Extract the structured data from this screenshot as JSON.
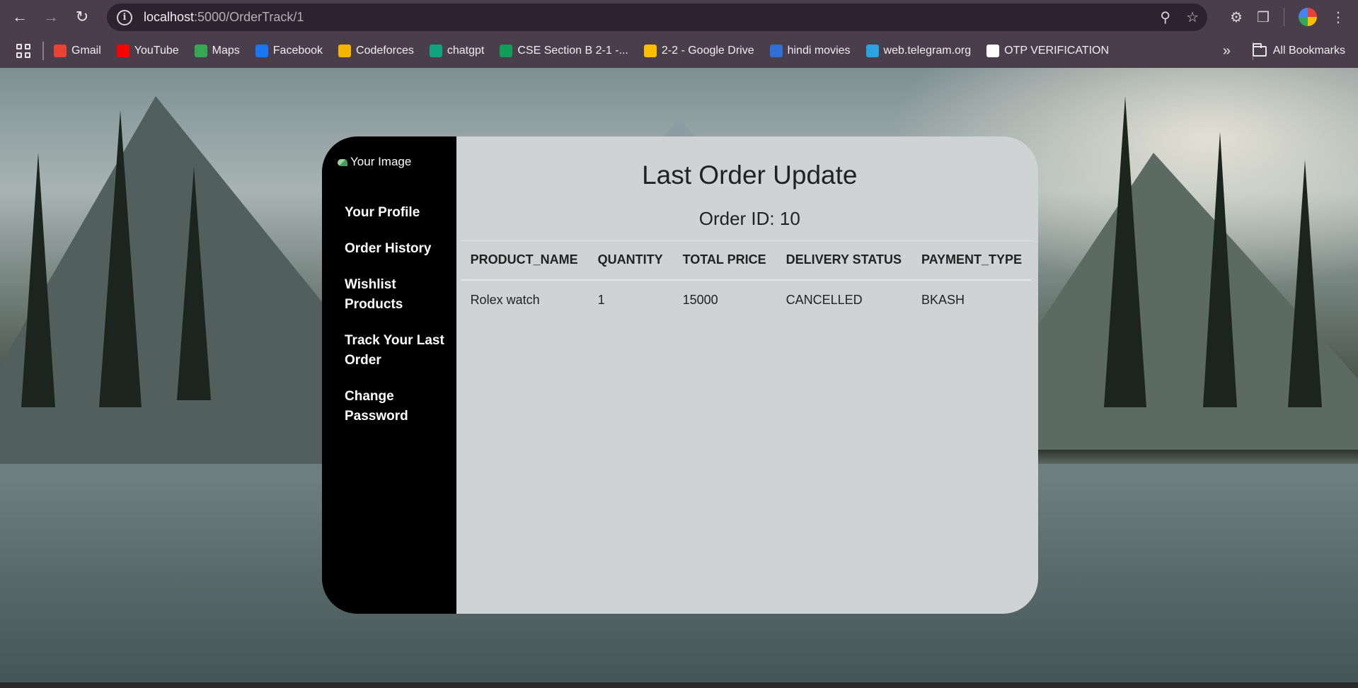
{
  "browser": {
    "url_host": "localhost",
    "url_path": ":5000/OrderTrack/1",
    "nav_icons": [
      "back-arrow-icon",
      "forward-arrow-icon",
      "reload-icon"
    ],
    "bookmarks": [
      {
        "label": "Gmail",
        "color": "#ea4335"
      },
      {
        "label": "YouTube",
        "color": "#ff0000"
      },
      {
        "label": "Maps",
        "color": "#34a853"
      },
      {
        "label": "Facebook",
        "color": "#1877f2"
      },
      {
        "label": "Codeforces",
        "color": "#f4b400"
      },
      {
        "label": "chatgpt",
        "color": "#10a37f"
      },
      {
        "label": "CSE Section B 2-1 -...",
        "color": "#0f9d58"
      },
      {
        "label": "2-2 - Google Drive",
        "color": "#fbbc04"
      },
      {
        "label": "hindi movies",
        "color": "#2f6fd6"
      },
      {
        "label": "web.telegram.org",
        "color": "#2aa3e0"
      },
      {
        "label": "OTP VERIFICATION",
        "color": "#ffffff"
      }
    ],
    "all_bookmarks": "All Bookmarks"
  },
  "sidebar": {
    "logo_alt": "Your Image",
    "items": [
      {
        "label": "Your Profile"
      },
      {
        "label": "Order History"
      },
      {
        "label": "Wishlist Products"
      },
      {
        "label": "Track Your Last Order"
      },
      {
        "label": "Change Password"
      }
    ]
  },
  "main": {
    "title": "Last Order Update",
    "order_id": "Order ID: 10",
    "columns": [
      "PRODUCT_NAME",
      "QUANTITY",
      "TOTAL PRICE",
      "DELIVERY STATUS",
      "PAYMENT_TYPE"
    ],
    "rows": [
      [
        "Rolex watch",
        "1",
        "15000",
        "CANCELLED",
        "BKASH"
      ]
    ]
  },
  "colors": {
    "sidebar_bg": "#000000",
    "content_bg": "#cfd3d4",
    "browser_chrome": "#4b3e4c"
  }
}
